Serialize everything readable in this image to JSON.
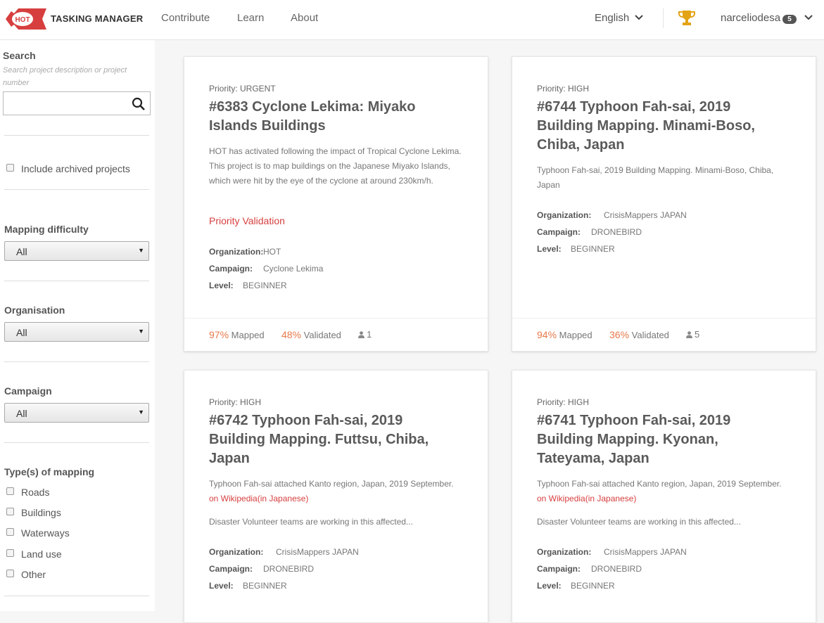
{
  "header": {
    "logo_text": "HOT",
    "brand": "TASKING MANAGER",
    "nav": [
      "Contribute",
      "Learn",
      "About"
    ],
    "language": "English",
    "username": "narceliodesa",
    "user_badge": "5"
  },
  "sidebar": {
    "search_heading": "Search",
    "search_hint": "Search project description or project number",
    "search_value": "",
    "archived_label": "Include archived projects",
    "difficulty_heading": "Mapping difficulty",
    "difficulty_value": "All",
    "organisation_heading": "Organisation",
    "organisation_value": "All",
    "campaign_heading": "Campaign",
    "campaign_value": "All",
    "types_heading": "Type(s) of mapping",
    "types": [
      "Roads",
      "Buildings",
      "Waterways",
      "Land use",
      "Other"
    ]
  },
  "labels": {
    "organization": "Organization:",
    "campaign": "Campaign:",
    "level": "Level:",
    "mapped": "Mapped",
    "validated": "Validated"
  },
  "projects": [
    {
      "priority": "Priority: URGENT",
      "title": "#6383 Cyclone Lekima: Miyako Islands Buildings",
      "description": "HOT has activated following the impact of Tropical Cyclone Lekima. This project is to map buildings on the Japanese Miyako Islands, which were hit by the eye of the cyclone at around 230km/h.",
      "priority_validation": "Priority Validation",
      "organization": "HOT",
      "campaign": "Cyclone Lekima",
      "level": "BEGINNER",
      "mapped": "97%",
      "validated": "48%",
      "contributors": "1"
    },
    {
      "priority": "Priority: HIGH",
      "title": "#6744 Typhoon Fah-sai, 2019 Building Mapping. Minami-Boso, Chiba, Japan",
      "description": "Typhoon Fah-sai, 2019 Building Mapping. Minami-Boso, Chiba, Japan",
      "organization": "CrisisMappers JAPAN",
      "campaign": "DRONEBIRD",
      "level": "BEGINNER",
      "mapped": "94%",
      "validated": "36%",
      "contributors": "5"
    },
    {
      "priority": "Priority: HIGH",
      "title": "#6742 Typhoon Fah-sai, 2019 Building Mapping. Futtsu, Chiba, Japan",
      "description": "Typhoon Fah-sai attached Kanto region, Japan, 2019 September.",
      "link": "on Wikipedia(in Japanese)",
      "description2": "Disaster Volunteer teams are working in this affected...",
      "organization": "CrisisMappers JAPAN",
      "campaign": "DRONEBIRD",
      "level": "BEGINNER"
    },
    {
      "priority": "Priority: HIGH",
      "title": "#6741 Typhoon Fah-sai, 2019 Building Mapping. Kyonan, Tateyama, Japan",
      "description": "Typhoon Fah-sai attached Kanto region, Japan, 2019 September.",
      "link": "on Wikipedia(in Japanese)",
      "description2": "Disaster Volunteer teams are working in this affected...",
      "organization": "CrisisMappers JAPAN",
      "campaign": "DRONEBIRD",
      "level": "BEGINNER"
    }
  ]
}
